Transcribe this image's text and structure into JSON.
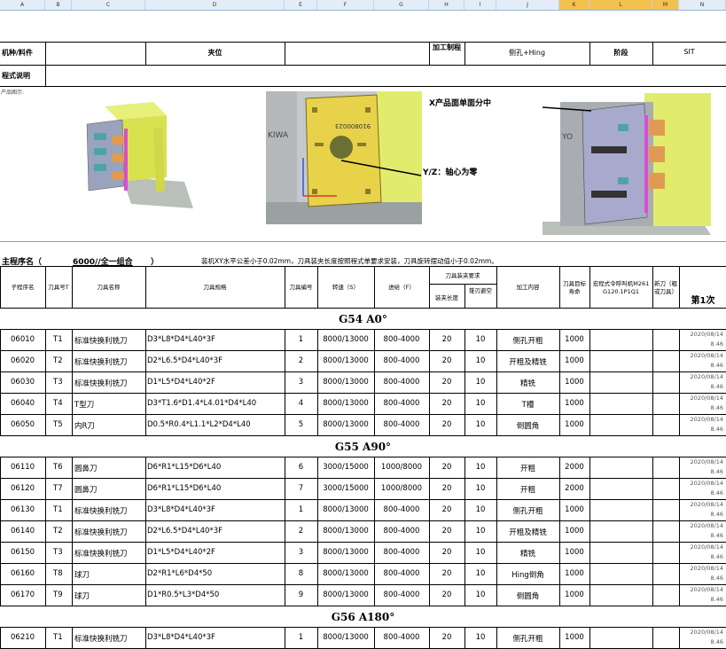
{
  "columns": [
    "A",
    "B",
    "C",
    "D",
    "E",
    "F",
    "G",
    "H",
    "I",
    "J",
    "K",
    "L",
    "M",
    "N"
  ],
  "header": {
    "part_label": "机种/料件",
    "position_label": "夹位",
    "process_label": "加工制程",
    "process_value": "侧孔+Hing",
    "stage_label": "阶段",
    "stage_value": "SIT",
    "desc_label": "程式说明",
    "image_note": "产品图示:"
  },
  "images": {
    "middle_plate_text": "910800023",
    "middle_side_text": "KIWA",
    "right_side_text": "YO",
    "annotation_x": "X产品面单面分中",
    "annotation_yz": "Y/Z：轴心为零"
  },
  "program": {
    "label": "主程序名（",
    "name": "6000//全一组合",
    "close": "）",
    "note": "装机XY水平公差小于0.02mm，刀具装夹长度按照程式单要求安装，刀具旋转摆动值小于0.02mm。"
  },
  "table_header": {
    "sub_program": "子程序名",
    "tool_no": "刀具号T",
    "tool_name": "刀具名称",
    "tool_spec": "刀具规格",
    "tool_number": "刀具编号",
    "speed": "转速（S）",
    "feed": "进给（F）",
    "clamp_group": "刀具装夹要求",
    "clamp_length": "装夹长度",
    "overhang": "锥刃避空",
    "process": "加工内容",
    "life": "刀具目标寿命",
    "cmd": "宏程式令呼叫机M261 G120.1P1Q1",
    "new_tool": "新刀（粗或刀具）",
    "first": "第1次"
  },
  "sections": [
    {
      "title": "G54  A0°",
      "rows": [
        {
          "sub": "06010",
          "t": "T1",
          "name": "标准快换利铣刀",
          "spec": "D3*L8*D4*L40*3F",
          "no": "1",
          "speed": "8000/13000",
          "feed": "800-4000",
          "clamp": "20",
          "over": "10",
          "content": "侧孔开粗",
          "life": "1000",
          "date": "2020/08/14",
          "time": "8.46"
        },
        {
          "sub": "06020",
          "t": "T2",
          "name": "标准快换利铣刀",
          "spec": "D2*L6.5*D4*L40*3F",
          "no": "2",
          "speed": "8000/13000",
          "feed": "800-4000",
          "clamp": "20",
          "over": "10",
          "content": "开粗及精铣",
          "life": "1000",
          "date": "2020/08/14",
          "time": "8.46"
        },
        {
          "sub": "06030",
          "t": "T3",
          "name": "标准快换利铣刀",
          "spec": "D1*L5*D4*L40*2F",
          "no": "3",
          "speed": "8000/13000",
          "feed": "800-4000",
          "clamp": "20",
          "over": "10",
          "content": "精铣",
          "life": "1000",
          "date": "2020/08/14",
          "time": "8.46"
        },
        {
          "sub": "06040",
          "t": "T4",
          "name": "T型刀",
          "spec": "D3*T1.6*D1.4*L4.01*D4*L40",
          "no": "4",
          "speed": "8000/13000",
          "feed": "800-4000",
          "clamp": "20",
          "over": "10",
          "content": "T槽",
          "life": "1000",
          "date": "2020/08/14",
          "time": "8.46"
        },
        {
          "sub": "06050",
          "t": "T5",
          "name": "内R刀",
          "spec": "D0.5*R0.4*L1.1*L2*D4*L40",
          "no": "5",
          "speed": "8000/13000",
          "feed": "800-4000",
          "clamp": "20",
          "over": "10",
          "content": "倒圆角",
          "life": "1000",
          "date": "2020/08/14",
          "time": "8.46"
        }
      ]
    },
    {
      "title": "G55  A90°",
      "rows": [
        {
          "sub": "06110",
          "t": "T6",
          "name": "圆鼻刀",
          "spec": "D6*R1*L15*D6*L40",
          "no": "6",
          "speed": "3000/15000",
          "feed": "1000/8000",
          "clamp": "20",
          "over": "10",
          "content": "开粗",
          "life": "2000",
          "date": "2020/08/14",
          "time": "8.46"
        },
        {
          "sub": "06120",
          "t": "T7",
          "name": "圆鼻刀",
          "spec": "D6*R1*L15*D6*L40",
          "no": "7",
          "speed": "3000/15000",
          "feed": "1000/8000",
          "clamp": "20",
          "over": "10",
          "content": "开粗",
          "life": "2000",
          "date": "2020/08/14",
          "time": "8.46"
        },
        {
          "sub": "06130",
          "t": "T1",
          "name": "标准快换利铣刀",
          "spec": "D3*L8*D4*L40*3F",
          "no": "1",
          "speed": "8000/13000",
          "feed": "800-4000",
          "clamp": "20",
          "over": "10",
          "content": "侧孔开粗",
          "life": "1000",
          "date": "2020/08/14",
          "time": "8.46"
        },
        {
          "sub": "06140",
          "t": "T2",
          "name": "标准快换利铣刀",
          "spec": "D2*L6.5*D4*L40*3F",
          "no": "2",
          "speed": "8000/13000",
          "feed": "800-4000",
          "clamp": "20",
          "over": "10",
          "content": "开粗及精铣",
          "life": "1000",
          "date": "2020/08/14",
          "time": "8.46"
        },
        {
          "sub": "06150",
          "t": "T3",
          "name": "标准快换利铣刀",
          "spec": "D1*L5*D4*L40*2F",
          "no": "3",
          "speed": "8000/13000",
          "feed": "800-4000",
          "clamp": "20",
          "over": "10",
          "content": "精铣",
          "life": "1000",
          "date": "2020/08/14",
          "time": "8.46"
        },
        {
          "sub": "06160",
          "t": "T8",
          "name": "球刀",
          "spec": "D2*R1*L6*D4*50",
          "no": "8",
          "speed": "8000/13000",
          "feed": "800-4000",
          "clamp": "20",
          "over": "10",
          "content": "Hing倒角",
          "life": "1000",
          "date": "2020/08/14",
          "time": "8.46"
        },
        {
          "sub": "06170",
          "t": "T9",
          "name": "球刀",
          "spec": "D1*R0.5*L3*D4*50",
          "no": "9",
          "speed": "8000/13000",
          "feed": "800-4000",
          "clamp": "20",
          "over": "10",
          "content": "倒圆角",
          "life": "1000",
          "date": "2020/08/14",
          "time": "8.46"
        }
      ]
    },
    {
      "title": "G56  A180°",
      "rows": [
        {
          "sub": "06210",
          "t": "T1",
          "name": "标准快换利铣刀",
          "spec": "D3*L8*D4*L40*3F",
          "no": "1",
          "speed": "8000/13000",
          "feed": "800-4000",
          "clamp": "20",
          "over": "10",
          "content": "侧孔开粗",
          "life": "1000",
          "date": "2020/08/14",
          "time": "8.46"
        }
      ]
    }
  ]
}
